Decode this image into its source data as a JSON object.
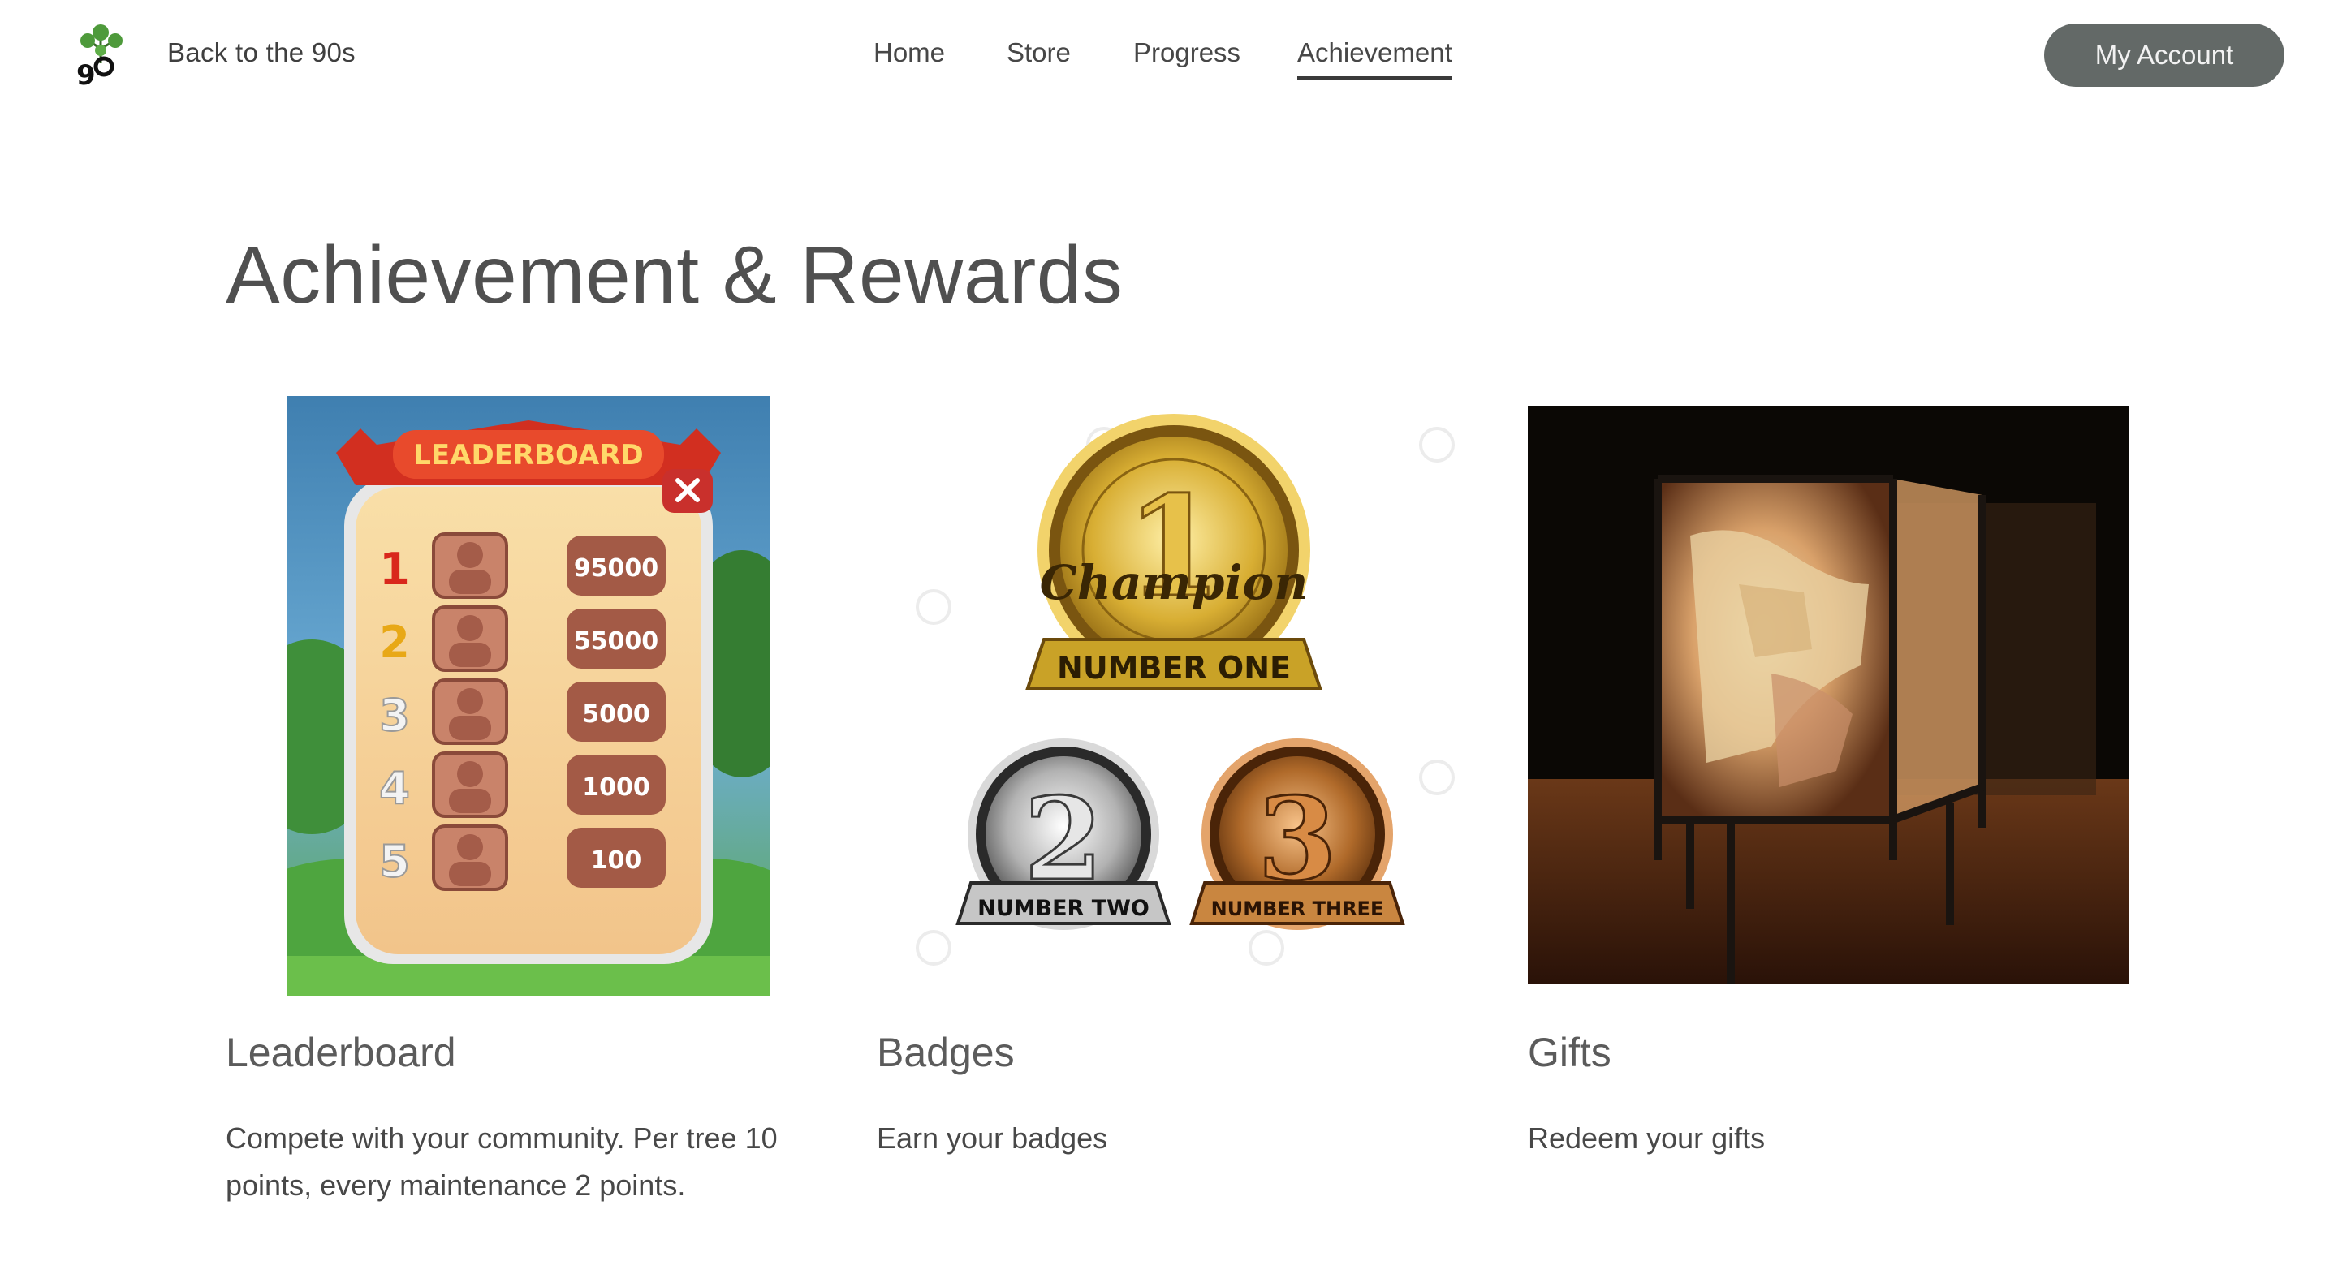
{
  "header": {
    "site_title": "Back to the 90s",
    "logo_icon": "tree-90-logo-icon",
    "nav": [
      {
        "label": "Home",
        "active": false
      },
      {
        "label": "Store",
        "active": false
      },
      {
        "label": "Progress",
        "active": false
      },
      {
        "label": "Achievement",
        "active": true
      }
    ],
    "account_label": "My Account",
    "colors": {
      "account_bg": "#636967",
      "logo_green": "#4e9a3b"
    }
  },
  "main": {
    "title": "Achievement & Rewards",
    "cards": [
      {
        "title": "Leaderboard",
        "description_lines": [
          "Compete with your community. Per tree 10",
          "points, every maintenance 2 points."
        ],
        "image": {
          "banner": "LEADERBOARD",
          "close_icon": "close-icon",
          "rows": [
            {
              "rank": "1",
              "score": "95000"
            },
            {
              "rank": "2",
              "score": "55000"
            },
            {
              "rank": "3",
              "score": "5000"
            },
            {
              "rank": "4",
              "score": "1000"
            },
            {
              "rank": "5",
              "score": "100"
            }
          ]
        }
      },
      {
        "title": "Badges",
        "description_lines": [
          "Earn your badges"
        ],
        "image": {
          "gold": {
            "numeral": "1",
            "script": "Champion",
            "ribbon": "NUMBER ONE",
            "color": "#c9a227"
          },
          "silver": {
            "numeral": "2",
            "ribbon": "NUMBER TWO",
            "color": "#a8a8a8"
          },
          "bronze": {
            "numeral": "3",
            "ribbon": "NUMBER THREE",
            "color": "#b06a2a"
          }
        }
      },
      {
        "title": "Gifts",
        "description_lines": [
          "Redeem your gifts"
        ],
        "image": {
          "subject": "map-lamp-photo"
        }
      }
    ]
  }
}
